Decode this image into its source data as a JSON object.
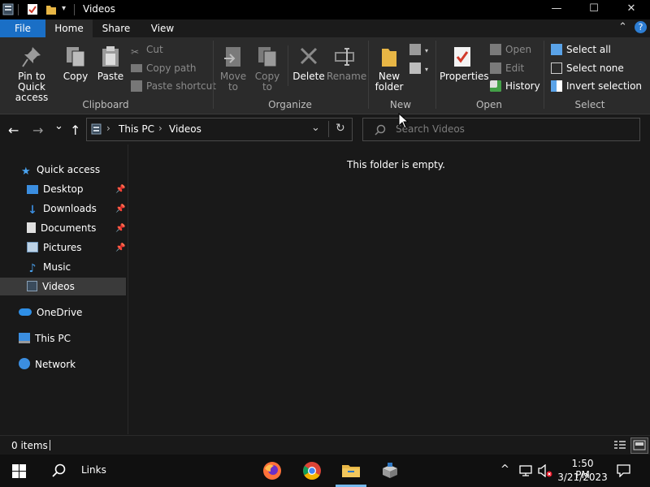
{
  "window": {
    "title": "Videos",
    "minimize_glyph": "—",
    "maximize_glyph": "☐",
    "close_glyph": "✕",
    "qa_dropdown_glyph": "▾"
  },
  "tabs": [
    {
      "label": "File"
    },
    {
      "label": "Home"
    },
    {
      "label": "Share"
    },
    {
      "label": "View"
    }
  ],
  "ribbon": {
    "collapse_glyph": "⌃",
    "help_glyph": "?",
    "clipboard": {
      "pin_label": "Pin to Quick access",
      "copy_label": "Copy",
      "paste_label": "Paste",
      "cut_label": "Cut",
      "copy_path_label": "Copy path",
      "paste_shortcut_label": "Paste shortcut",
      "group_label": "Clipboard"
    },
    "organize": {
      "move_to_label": "Move to",
      "copy_to_label": "Copy to",
      "delete_label": "Delete",
      "rename_label": "Rename",
      "group_label": "Organize"
    },
    "new": {
      "new_folder_label": "New folder",
      "group_label": "New"
    },
    "open": {
      "properties_label": "Properties",
      "open_label": "Open",
      "edit_label": "Edit",
      "history_label": "History",
      "group_label": "Open"
    },
    "select": {
      "select_all_label": "Select all",
      "select_none_label": "Select none",
      "invert_label": "Invert selection",
      "group_label": "Select"
    }
  },
  "navigation": {
    "back_glyph": "←",
    "forward_glyph": "→",
    "recent_glyph": "⌄",
    "up_glyph": "↑",
    "breadcrumb": [
      "This PC",
      "Videos"
    ],
    "breadcrumb_separator": "›",
    "refresh_glyph": "↻",
    "search_placeholder": "Search Videos"
  },
  "sidebar": {
    "quick_access": "Quick access",
    "items": [
      {
        "label": "Desktop",
        "pinned": true
      },
      {
        "label": "Downloads",
        "pinned": true
      },
      {
        "label": "Documents",
        "pinned": true
      },
      {
        "label": "Pictures",
        "pinned": true
      },
      {
        "label": "Music",
        "pinned": false
      },
      {
        "label": "Videos",
        "pinned": false
      }
    ],
    "onedrive": "OneDrive",
    "this_pc": "This PC",
    "network": "Network",
    "pin_glyph": "📌"
  },
  "content": {
    "empty_message": "This folder is empty."
  },
  "status": {
    "item_count": "0 items"
  },
  "taskbar": {
    "search_label": "Links",
    "time": "1:50 PM",
    "date": "3/21/2023",
    "tray_chevron": "^",
    "notification_glyph": "🗨"
  },
  "colors": {
    "accent": "#1a6fc6",
    "folder": "#e8b645",
    "window_bg": "#191919",
    "ribbon_bg": "#2b2b2b"
  }
}
